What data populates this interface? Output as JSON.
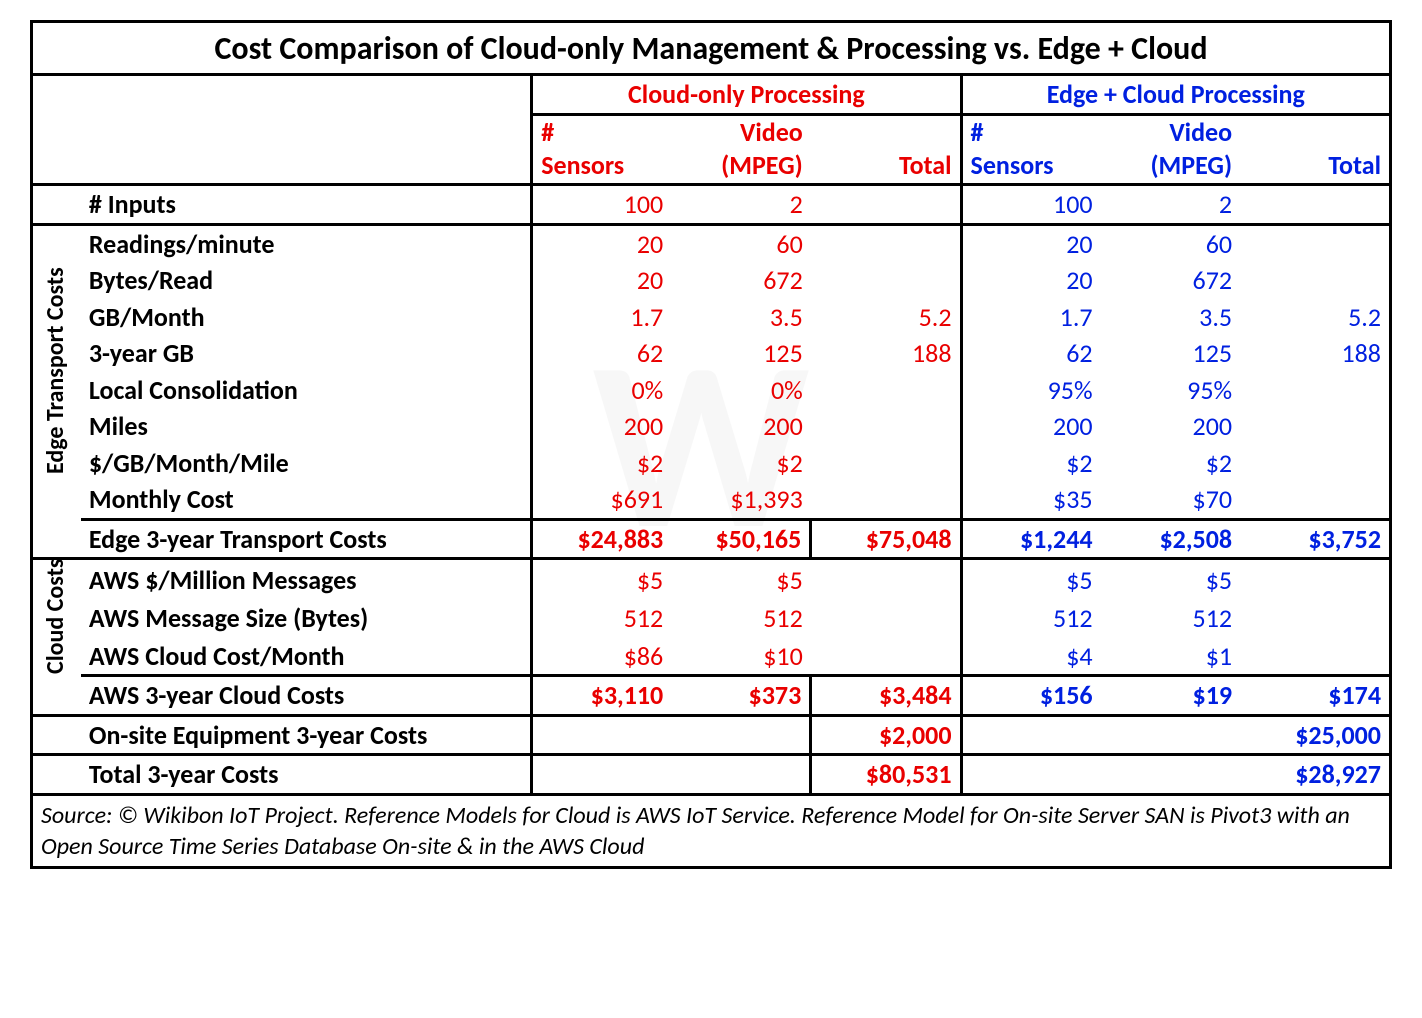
{
  "title": "Cost Comparison of Cloud-only Management & Processing vs. Edge + Cloud",
  "groups": {
    "cloud": {
      "header": "Cloud-only Processing",
      "col1": "# Sensors",
      "col2": "Video (MPEG)",
      "col3": "Total"
    },
    "edge": {
      "header": "Edge + Cloud Processing",
      "col1": "# Sensors",
      "col2": "Video (MPEG)",
      "col3": "Total"
    }
  },
  "side": {
    "transport": "Edge Transport Costs",
    "cloud": "Cloud Costs"
  },
  "rows": {
    "inputs": {
      "label": "# Inputs",
      "c1": "100",
      "c2": "2",
      "ct": "",
      "e1": "100",
      "e2": "2",
      "et": ""
    },
    "rpm": {
      "label": "Readings/minute",
      "c1": "20",
      "c2": "60",
      "ct": "",
      "e1": "20",
      "e2": "60",
      "et": ""
    },
    "bpr": {
      "label": "Bytes/Read",
      "c1": "20",
      "c2": "672",
      "ct": "",
      "e1": "20",
      "e2": "672",
      "et": ""
    },
    "gbm": {
      "label": "GB/Month",
      "c1": "1.7",
      "c2": "3.5",
      "ct": "5.2",
      "e1": "1.7",
      "e2": "3.5",
      "et": "5.2"
    },
    "gb3": {
      "label": "3-year GB",
      "c1": "62",
      "c2": "125",
      "ct": "188",
      "e1": "62",
      "e2": "125",
      "et": "188"
    },
    "consol": {
      "label": "Local Consolidation",
      "c1": "0%",
      "c2": "0%",
      "ct": "",
      "e1": "95%",
      "e2": "95%",
      "et": ""
    },
    "miles": {
      "label": "Miles",
      "c1": "200",
      "c2": "200",
      "ct": "",
      "e1": "200",
      "e2": "200",
      "et": ""
    },
    "rate": {
      "label": "$/GB/Month/Mile",
      "c1": "$2",
      "c2": "$2",
      "ct": "",
      "e1": "$2",
      "e2": "$2",
      "et": ""
    },
    "mcost": {
      "label": "Monthly Cost",
      "c1": "$691",
      "c2": "$1,393",
      "ct": "",
      "e1": "$35",
      "e2": "$70",
      "et": ""
    },
    "edge3": {
      "label": "Edge 3-year Transport Costs",
      "c1": "$24,883",
      "c2": "$50,165",
      "ct": "$75,048",
      "e1": "$1,244",
      "e2": "$2,508",
      "et": "$3,752"
    },
    "awsmm": {
      "label": "AWS $/Million Messages",
      "c1": "$5",
      "c2": "$5",
      "ct": "",
      "e1": "$5",
      "e2": "$5",
      "et": ""
    },
    "awsms": {
      "label": "AWS Message Size (Bytes)",
      "c1": "512",
      "c2": "512",
      "ct": "",
      "e1": "512",
      "e2": "512",
      "et": ""
    },
    "awscm": {
      "label": "AWS Cloud Cost/Month",
      "c1": "$86",
      "c2": "$10",
      "ct": "",
      "e1": "$4",
      "e2": "$1",
      "et": ""
    },
    "aws3": {
      "label": "AWS 3-year Cloud Costs",
      "c1": "$3,110",
      "c2": "$373",
      "ct": "$3,484",
      "e1": "$156",
      "e2": "$19",
      "et": "$174"
    },
    "onsite": {
      "label": "On-site Equipment 3-year Costs",
      "c1": "",
      "c2": "",
      "ct": "$2,000",
      "e1": "",
      "e2": "",
      "et": "$25,000"
    },
    "total": {
      "label": "Total 3-year Costs",
      "c1": "",
      "c2": "",
      "ct": "$80,531",
      "e1": "",
      "e2": "",
      "et": "$28,927"
    }
  },
  "footnote": "Source: © Wikibon IoT Project. Reference Models for Cloud is AWS IoT Service. Reference Model for On-site Server SAN is Pivot3 with an Open Source Time Series Database On-site & in the AWS Cloud",
  "chart_data": {
    "type": "table",
    "title": "Cost Comparison of Cloud-only Management & Processing vs. Edge + Cloud",
    "column_groups": [
      "Cloud-only Processing",
      "Edge + Cloud Processing"
    ],
    "columns_per_group": [
      "# Sensors",
      "Video (MPEG)",
      "Total"
    ],
    "row_groups": {
      "": [
        "# Inputs"
      ],
      "Edge Transport Costs": [
        "Readings/minute",
        "Bytes/Read",
        "GB/Month",
        "3-year GB",
        "Local Consolidation",
        "Miles",
        "$/GB/Month/Mile",
        "Monthly Cost",
        "Edge 3-year Transport Costs"
      ],
      "Cloud Costs": [
        "AWS $/Million Messages",
        "AWS Message Size (Bytes)",
        "AWS Cloud Cost/Month",
        "AWS 3-year Cloud Costs"
      ],
      " ": [
        "On-site Equipment 3-year Costs",
        "Total 3-year Costs"
      ]
    },
    "data": {
      "# Inputs": {
        "cloud": [
          100,
          2,
          null
        ],
        "edge": [
          100,
          2,
          null
        ]
      },
      "Readings/minute": {
        "cloud": [
          20,
          60,
          null
        ],
        "edge": [
          20,
          60,
          null
        ]
      },
      "Bytes/Read": {
        "cloud": [
          20,
          672,
          null
        ],
        "edge": [
          20,
          672,
          null
        ]
      },
      "GB/Month": {
        "cloud": [
          1.7,
          3.5,
          5.2
        ],
        "edge": [
          1.7,
          3.5,
          5.2
        ]
      },
      "3-year GB": {
        "cloud": [
          62,
          125,
          188
        ],
        "edge": [
          62,
          125,
          188
        ]
      },
      "Local Consolidation": {
        "cloud": [
          "0%",
          "0%",
          null
        ],
        "edge": [
          "95%",
          "95%",
          null
        ]
      },
      "Miles": {
        "cloud": [
          200,
          200,
          null
        ],
        "edge": [
          200,
          200,
          null
        ]
      },
      "$/GB/Month/Mile": {
        "cloud": [
          2,
          2,
          null
        ],
        "edge": [
          2,
          2,
          null
        ]
      },
      "Monthly Cost": {
        "cloud": [
          691,
          1393,
          null
        ],
        "edge": [
          35,
          70,
          null
        ]
      },
      "Edge 3-year Transport Costs": {
        "cloud": [
          24883,
          50165,
          75048
        ],
        "edge": [
          1244,
          2508,
          3752
        ]
      },
      "AWS $/Million Messages": {
        "cloud": [
          5,
          5,
          null
        ],
        "edge": [
          5,
          5,
          null
        ]
      },
      "AWS Message Size (Bytes)": {
        "cloud": [
          512,
          512,
          null
        ],
        "edge": [
          512,
          512,
          null
        ]
      },
      "AWS Cloud Cost/Month": {
        "cloud": [
          86,
          10,
          null
        ],
        "edge": [
          4,
          1,
          null
        ]
      },
      "AWS 3-year Cloud Costs": {
        "cloud": [
          3110,
          373,
          3484
        ],
        "edge": [
          156,
          19,
          174
        ]
      },
      "On-site Equipment 3-year Costs": {
        "cloud": [
          null,
          null,
          2000
        ],
        "edge": [
          null,
          null,
          25000
        ]
      },
      "Total 3-year Costs": {
        "cloud": [
          null,
          null,
          80531
        ],
        "edge": [
          null,
          null,
          28927
        ]
      }
    }
  }
}
